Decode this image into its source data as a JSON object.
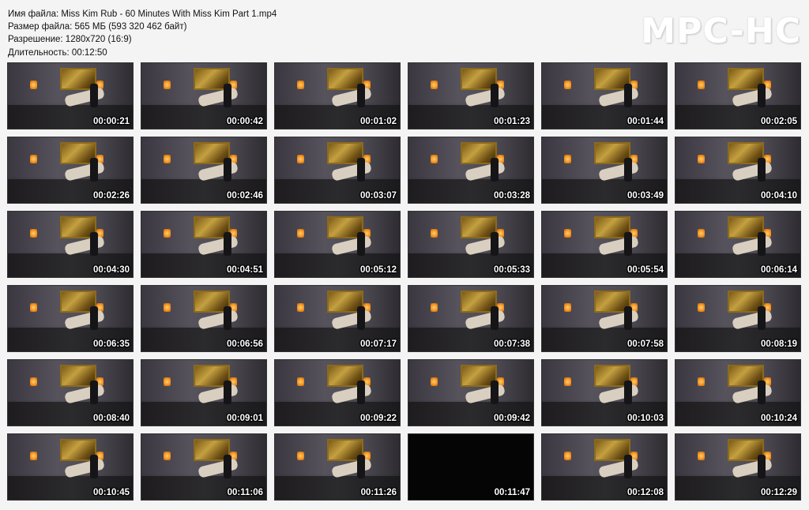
{
  "info": {
    "filename": "Имя файла: Miss Kim Rub - 60 Minutes With Miss Kim Part 1.mp4",
    "filesize": "Размер файла: 565 МБ (593 320 462 байт)",
    "resolution": "Разрешение: 1280x720 (16:9)",
    "duration": "Длительность: 00:12:50"
  },
  "logo": "MPC-HC",
  "thumbnails": [
    {
      "time": "00:00:21"
    },
    {
      "time": "00:00:42"
    },
    {
      "time": "00:01:02"
    },
    {
      "time": "00:01:23"
    },
    {
      "time": "00:01:44"
    },
    {
      "time": "00:02:05"
    },
    {
      "time": "00:02:26"
    },
    {
      "time": "00:02:46"
    },
    {
      "time": "00:03:07"
    },
    {
      "time": "00:03:28"
    },
    {
      "time": "00:03:49"
    },
    {
      "time": "00:04:10"
    },
    {
      "time": "00:04:30"
    },
    {
      "time": "00:04:51"
    },
    {
      "time": "00:05:12"
    },
    {
      "time": "00:05:33"
    },
    {
      "time": "00:05:54"
    },
    {
      "time": "00:06:14"
    },
    {
      "time": "00:06:35"
    },
    {
      "time": "00:06:56"
    },
    {
      "time": "00:07:17"
    },
    {
      "time": "00:07:38"
    },
    {
      "time": "00:07:58"
    },
    {
      "time": "00:08:19"
    },
    {
      "time": "00:08:40"
    },
    {
      "time": "00:09:01"
    },
    {
      "time": "00:09:22"
    },
    {
      "time": "00:09:42"
    },
    {
      "time": "00:10:03"
    },
    {
      "time": "00:10:24"
    },
    {
      "time": "00:10:45"
    },
    {
      "time": "00:11:06"
    },
    {
      "time": "00:11:26"
    },
    {
      "time": "00:11:47",
      "black": true
    },
    {
      "time": "00:12:08"
    },
    {
      "time": "00:12:29"
    }
  ]
}
